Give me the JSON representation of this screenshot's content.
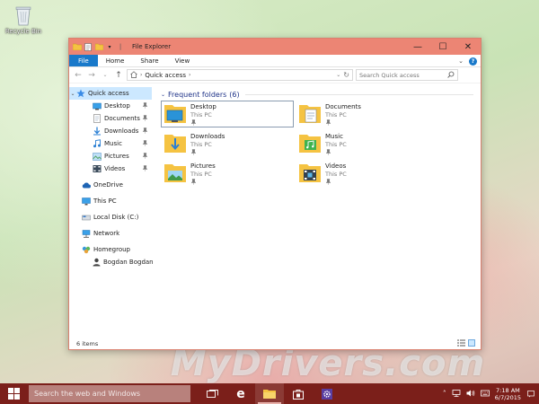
{
  "desktop": {
    "recycle_bin_label": "Recycle Bin",
    "watermark": "MyDrivers.com"
  },
  "window": {
    "title": "File Explorer",
    "controls": {
      "minimize": "—",
      "maximize": "☐",
      "close": "✕"
    }
  },
  "ribbon": {
    "tabs": [
      {
        "label": "File"
      },
      {
        "label": "Home"
      },
      {
        "label": "Share"
      },
      {
        "label": "View"
      }
    ],
    "help": "?"
  },
  "address": {
    "crumb": "Quick access",
    "search_placeholder": "Search Quick access"
  },
  "navigation": {
    "quick_access": "Quick access",
    "pinned": [
      {
        "label": "Desktop"
      },
      {
        "label": "Documents"
      },
      {
        "label": "Downloads"
      },
      {
        "label": "Music"
      },
      {
        "label": "Pictures"
      },
      {
        "label": "Videos"
      }
    ],
    "onedrive": "OneDrive",
    "this_pc": "This PC",
    "local_disk": "Local Disk (C:)",
    "network": "Network",
    "homegroup": "Homegroup",
    "user": "Bogdan Bogdan"
  },
  "content": {
    "group_title": "Frequent folders",
    "group_count": "(6)",
    "folders": [
      {
        "name": "Desktop",
        "location": "This PC"
      },
      {
        "name": "Documents",
        "location": "This PC"
      },
      {
        "name": "Downloads",
        "location": "This PC"
      },
      {
        "name": "Music",
        "location": "This PC"
      },
      {
        "name": "Pictures",
        "location": "This PC"
      },
      {
        "name": "Videos",
        "location": "This PC"
      }
    ]
  },
  "status": {
    "items": "6 items"
  },
  "taskbar": {
    "search_placeholder": "Search the web and Windows",
    "time": "7:18 AM",
    "date": "6/7/2015"
  },
  "colors": {
    "titlebar": "#ec8574",
    "accent": "#1979ca",
    "taskbar": "#7b1f1a",
    "folder": "#f5c342"
  }
}
